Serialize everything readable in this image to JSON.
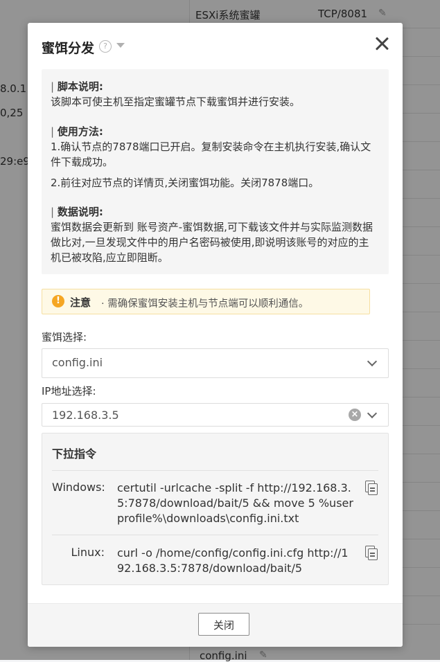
{
  "background": {
    "left_texts": [
      "8.0.1",
      "0,25",
      "29:e9"
    ],
    "rows": [
      {
        "name": "ESXi系统蜜罐",
        "proto": "TCP/8081"
      },
      {
        "name": "config.ini",
        "proto": ""
      }
    ]
  },
  "dialog": {
    "title": "蜜饵分发",
    "help_glyph": "?",
    "sections": {
      "script_title": "脚本说明:",
      "script_text": "该脚本可使主机至指定蜜罐节点下载蜜饵并进行安装。",
      "usage_title": "使用方法:",
      "usage_step1": "1.确认节点的7878端口已开启。复制安装命令在主机执行安装,确认文件下载成功。",
      "usage_step2": "2.前往对应节点的详情页,关闭蜜饵功能。关闭7878端口。",
      "data_title": "数据说明:",
      "data_text": "蜜饵数据会更新到 账号资产-蜜饵数据,可下载该文件并与实际监测数据做比对,一旦发现文件中的用户名密码被使用,即说明该账号的对应的主机已被攻陷,应立即阻断。"
    },
    "notice": {
      "icon": "!",
      "label": "注意",
      "text": "· 需确保蜜饵安装主机与节点端可以顺利通信。"
    },
    "bait_select": {
      "label": "蜜饵选择:",
      "value": "config.ini"
    },
    "ip_select": {
      "label": "IP地址选择:",
      "value": "192.168.3.5"
    },
    "commands": {
      "title": "下拉指令",
      "windows_label": "Windows:",
      "windows_cmd": "certutil -urlcache -split -f http://192.168.3.5:7878/download/bait/5 && move 5 %userprofile%\\downloads\\config.ini.txt",
      "linux_label": "Linux:",
      "linux_cmd": "curl -o /home/config/config.ini.cfg http://192.168.3.5:7878/download/bait/5"
    },
    "close_button": "关闭"
  },
  "icons": {
    "help": "question-circle-icon",
    "dropdown": "caret-down-icon",
    "close": "close-icon",
    "warning": "exclamation-circle-icon",
    "chevron": "chevron-down-icon",
    "clear": "clear-circle-icon",
    "copy": "copy-icon",
    "edit": "pencil-icon"
  },
  "colors": {
    "overlay": "#000000",
    "warning": "#f5a623",
    "notice_bg": "#fef9e6"
  }
}
